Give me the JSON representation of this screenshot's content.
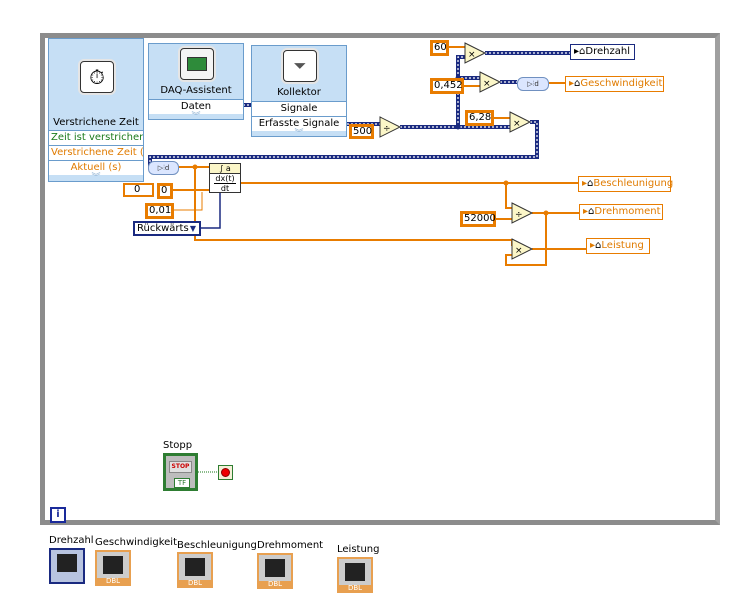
{
  "elapsed_time": {
    "label": "Verstrichene Zeit",
    "rows": [
      "Zeit ist verstrichen",
      "Verstrichene Zeit (",
      "Aktuell (s)"
    ]
  },
  "daq": {
    "label": "DAQ-Assistent",
    "rows": [
      "Daten"
    ]
  },
  "collector": {
    "label": "Kollektor",
    "rows": [
      "Signale",
      "Erfasste Signale"
    ]
  },
  "constants": {
    "c500": "500",
    "c60": "60",
    "c0452": "0,452",
    "c628": "6,28",
    "c52000": "52000",
    "c0a": "0",
    "c0b": "0",
    "c001": "0,01"
  },
  "enum": {
    "value": "Rückwärts"
  },
  "derivative": {
    "top": "∫ a",
    "frac_top": "dx(t)",
    "frac_bottom": "dt"
  },
  "operators": {
    "multiply": "×",
    "divide": "÷"
  },
  "indicators": {
    "drehzahl": "Drehzahl",
    "geschwindigkeit": "Geschwindigkeit",
    "beschleunigung": "Beschleunigung",
    "drehmoment": "Drehmoment",
    "leistung": "Leistung"
  },
  "stop": {
    "label": "Stopp",
    "button_text": "STOP",
    "tf": "TF"
  },
  "loop_iteration": "i",
  "front_panel_terminals": [
    {
      "label": "Drehzahl",
      "type": ""
    },
    {
      "label": "Geschwindigkeit",
      "type": "DBL"
    },
    {
      "label": "Beschleunigung",
      "type": "DBL"
    },
    {
      "label": "Drehmoment",
      "type": "DBL"
    },
    {
      "label": "Leistung",
      "type": "DBL"
    }
  ],
  "colors": {
    "orange_wire": "#e87c00",
    "dynamic_wire": "#1a2a80",
    "boolean": "#1a7a1a",
    "loop_frame": "#8c8c8c",
    "node_fill": "#c6dff5"
  }
}
